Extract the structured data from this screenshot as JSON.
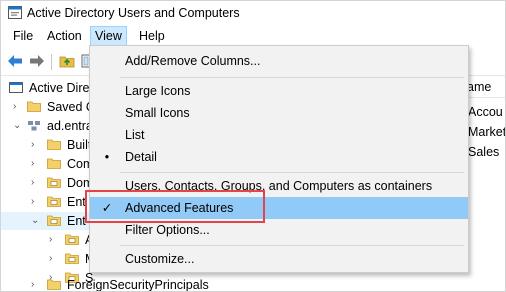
{
  "window": {
    "title": "Active Directory Users and Computers"
  },
  "menubar": {
    "items": [
      "File",
      "Action",
      "View",
      "Help"
    ],
    "active_index": 2
  },
  "tree": {
    "rows": [
      {
        "label": "Active Directory Users and C",
        "indent": 0,
        "caret": "",
        "icon": "ad-console-icon"
      },
      {
        "label": "Saved Q",
        "indent": 1,
        "caret": "›",
        "icon": "folder-icon"
      },
      {
        "label": "ad.entra",
        "indent": 1,
        "caret": "⌄",
        "icon": "domain-icon"
      },
      {
        "label": "Built",
        "indent": 2,
        "caret": "›",
        "icon": "folder-icon"
      },
      {
        "label": "Com",
        "indent": 2,
        "caret": "›",
        "icon": "folder-icon"
      },
      {
        "label": "Dom",
        "indent": 2,
        "caret": "›",
        "icon": "ou-icon"
      },
      {
        "label": "Ent",
        "indent": 2,
        "caret": "›",
        "icon": "ou-icon"
      },
      {
        "label": "Ent",
        "indent": 2,
        "caret": "⌄",
        "icon": "ou-icon"
      },
      {
        "label": "A",
        "indent": 3,
        "caret": "›",
        "icon": "ou-icon"
      },
      {
        "label": "M",
        "indent": 3,
        "caret": "›",
        "icon": "ou-icon"
      },
      {
        "label": "S",
        "indent": 3,
        "caret": "›",
        "icon": "ou-icon"
      },
      {
        "label": "ForeignSecurityPrincipals",
        "indent": 2,
        "caret": "›",
        "icon": "folder-icon"
      }
    ]
  },
  "right_pane": {
    "header": "ame",
    "cells": [
      "Accou",
      "Market",
      "Sales"
    ]
  },
  "view_menu": {
    "items": [
      {
        "label": "Add/Remove Columns...",
        "mark": ""
      },
      {
        "separator": true
      },
      {
        "label": "Large Icons",
        "mark": ""
      },
      {
        "label": "Small Icons",
        "mark": ""
      },
      {
        "label": "List",
        "mark": ""
      },
      {
        "label": "Detail",
        "mark": "•"
      },
      {
        "separator": true
      },
      {
        "label": "Users, Contacts, Groups, and Computers as containers",
        "mark": ""
      },
      {
        "label": "Advanced Features",
        "mark": "✓",
        "hover": true
      },
      {
        "label": "Filter Options...",
        "mark": ""
      },
      {
        "separator": true
      },
      {
        "label": "Customize...",
        "mark": ""
      }
    ]
  },
  "colors": {
    "accent": "#0078d7",
    "highlight_border": "#e0454c",
    "menu_hover": "#91c9f7"
  }
}
